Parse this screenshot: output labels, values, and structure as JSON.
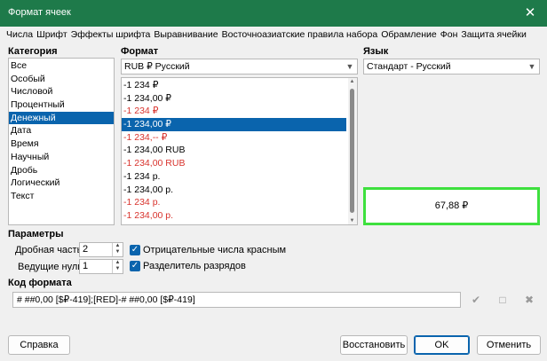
{
  "window": {
    "title": "Формат ячеек",
    "close_glyph": "✕"
  },
  "tabs": [
    "Числа",
    "Шрифт",
    "Эффекты шрифта",
    "Выравнивание",
    "Восточноазиатские правила набора",
    "Обрамление",
    "Фон",
    "Защита ячейки"
  ],
  "category": {
    "label": "Категория",
    "items": [
      "Все",
      "Особый",
      "Числовой",
      "Процентный",
      "Денежный",
      "Дата",
      "Время",
      "Научный",
      "Дробь",
      "Логический",
      "Текст"
    ],
    "selected_index": 4
  },
  "format": {
    "label": "Формат",
    "currency_value": "RUB  ₽  Русский",
    "items": [
      {
        "text": "-1 234 ₽",
        "red": false
      },
      {
        "text": "-1 234,00 ₽",
        "red": false
      },
      {
        "text": "-1 234 ₽",
        "red": true
      },
      {
        "text": "-1 234,00 ₽",
        "red": true
      },
      {
        "text": "-1 234,-- ₽",
        "red": true
      },
      {
        "text": "-1 234,00 RUB",
        "red": false
      },
      {
        "text": "-1 234,00 RUB",
        "red": true
      },
      {
        "text": "-1 234 р.",
        "red": false
      },
      {
        "text": "-1 234,00 р.",
        "red": false
      },
      {
        "text": "-1 234 р.",
        "red": true
      },
      {
        "text": "-1 234,00 р.",
        "red": true
      }
    ],
    "selected_index": 3
  },
  "language": {
    "label": "Язык",
    "value": "Стандарт - Русский"
  },
  "preview": {
    "value": "67,88 ₽"
  },
  "options": {
    "label": "Параметры",
    "decimal_label": "Дробная часть:",
    "decimal_value": "2",
    "leading_zeros_label": "Ведущие нули:",
    "leading_zeros_value": "1",
    "negative_red_label": "Отрицательные числа красным",
    "thousands_sep_label": "Разделитель разрядов"
  },
  "format_code": {
    "label": "Код формата",
    "value": "# ##0,00 [$₽-419];[RED]-# ##0,00 [$₽-419]"
  },
  "buttons": {
    "help": "Справка",
    "reset": "Восстановить",
    "ok": "OK",
    "cancel": "Отменить"
  }
}
